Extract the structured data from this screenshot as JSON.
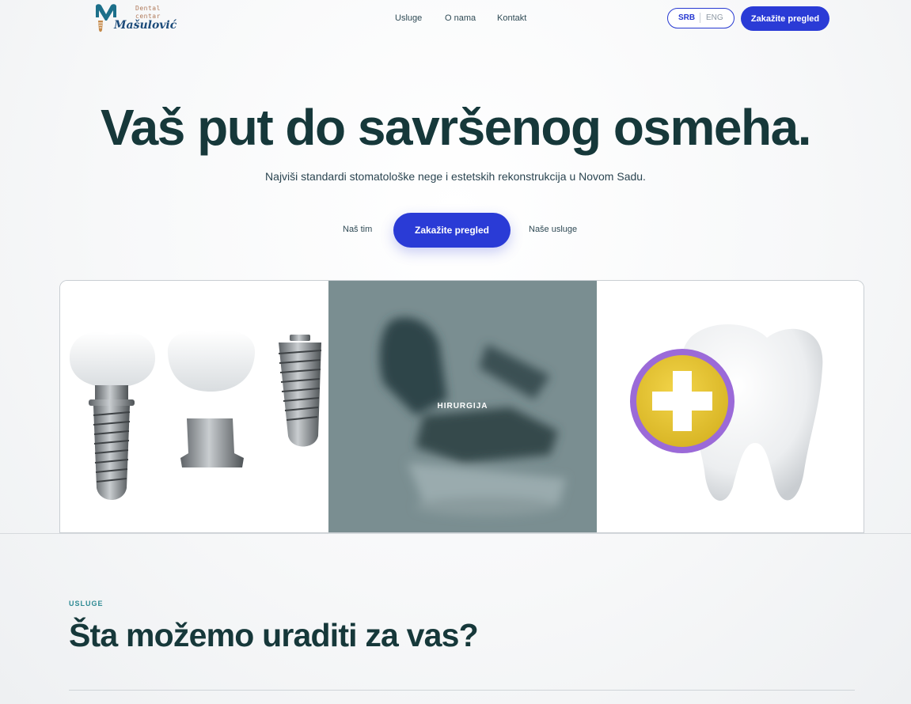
{
  "header": {
    "logo": {
      "line1": "Dental",
      "line2": "centar",
      "name": "Mašulović"
    },
    "nav": [
      {
        "label": "Usluge"
      },
      {
        "label": "O nama"
      },
      {
        "label": "Kontakt"
      }
    ],
    "language": {
      "active": "SRB",
      "other": "ENG"
    },
    "cta_label": "Zakažite pregled"
  },
  "hero": {
    "title": "Vaš put do savršenog osmeha.",
    "subtitle": "Najviši standardi stomatološke nege i estetskih rekonstrukcija u Novom Sadu.",
    "secondary_link_left": "Naš tim",
    "primary_cta": "Zakažite pregled",
    "secondary_link_right": "Naše usluge"
  },
  "cards": [
    {
      "label": ""
    },
    {
      "label": "HIRURGIJA"
    },
    {
      "label": ""
    }
  ],
  "services": {
    "eyebrow": "USLUGE",
    "title": "Šta možemo uraditi za vas?"
  },
  "colors": {
    "primary": "#2a3bd6",
    "heading": "#16383a",
    "accent_teal": "#2e8a93",
    "card_overlay": "#7a8e91"
  }
}
